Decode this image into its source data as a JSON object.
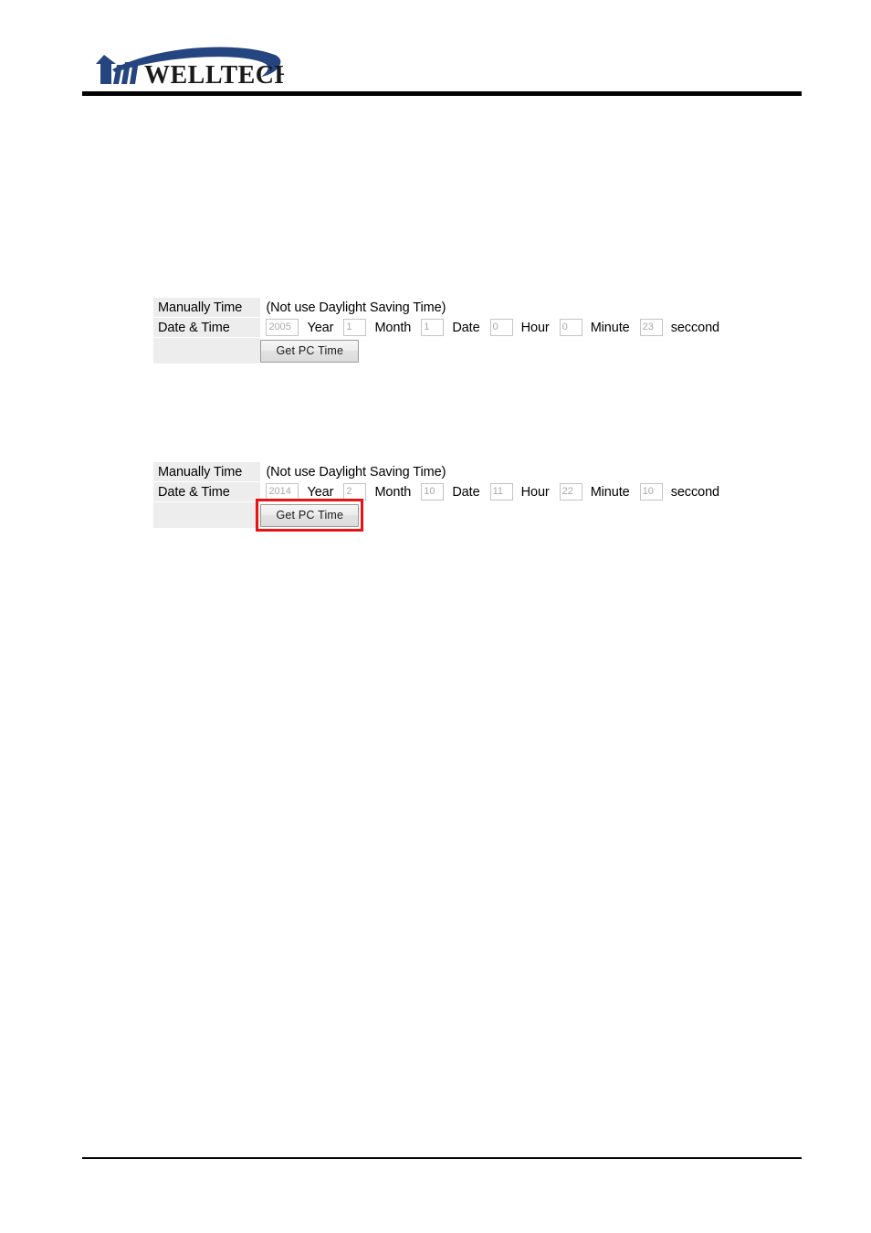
{
  "header": {
    "brand_name": "WELLTECH",
    "logo_color": "#24457f",
    "rule_color": "#000000"
  },
  "sections": [
    {
      "id": "before",
      "manual_time_label": "Manually Time",
      "daylight_note": "(Not use Daylight Saving Time)",
      "datetime_label": "Date & Time",
      "fields": [
        {
          "name": "year",
          "value": "2005",
          "unit": "Year"
        },
        {
          "name": "month",
          "value": "1",
          "unit": "Month"
        },
        {
          "name": "date",
          "value": "1",
          "unit": "Date"
        },
        {
          "name": "hour",
          "value": "0",
          "unit": "Hour"
        },
        {
          "name": "minute",
          "value": "0",
          "unit": "Minute"
        },
        {
          "name": "seccond",
          "value": "23",
          "unit": "seccond"
        }
      ],
      "button_label": "Get PC Time",
      "button_highlighted": false
    },
    {
      "id": "after",
      "manual_time_label": "Manually Time",
      "daylight_note": "(Not use Daylight Saving Time)",
      "datetime_label": "Date & Time",
      "fields": [
        {
          "name": "year",
          "value": "2014",
          "unit": "Year"
        },
        {
          "name": "month",
          "value": "2",
          "unit": "Month"
        },
        {
          "name": "date",
          "value": "10",
          "unit": "Date"
        },
        {
          "name": "hour",
          "value": "11",
          "unit": "Hour"
        },
        {
          "name": "minute",
          "value": "22",
          "unit": "Minute"
        },
        {
          "name": "seccond",
          "value": "10",
          "unit": "seccond"
        }
      ],
      "button_label": "Get PC Time",
      "button_highlighted": true,
      "highlight_color": "#e81313"
    }
  ]
}
